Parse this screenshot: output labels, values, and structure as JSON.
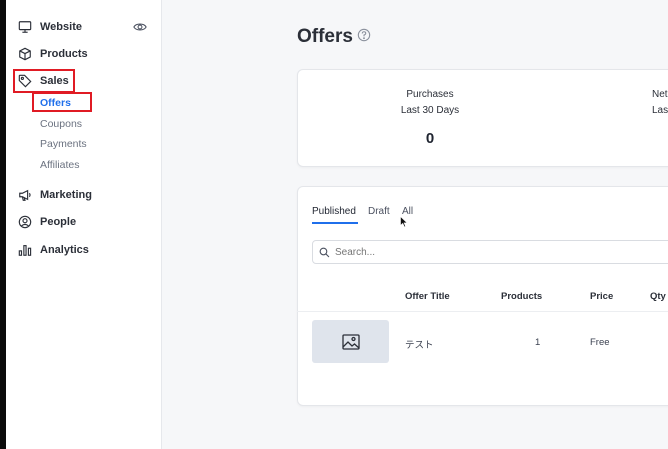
{
  "sidebar": {
    "items": [
      {
        "label": "Website",
        "icon": "monitor-icon"
      },
      {
        "label": "Products",
        "icon": "box-icon"
      },
      {
        "label": "Sales",
        "icon": "tag-icon"
      },
      {
        "label": "Marketing",
        "icon": "megaphone-icon"
      },
      {
        "label": "People",
        "icon": "person-icon"
      },
      {
        "label": "Analytics",
        "icon": "bar-chart-icon"
      }
    ],
    "sales_subitems": [
      "Offers",
      "Coupons",
      "Payments",
      "Affiliates"
    ],
    "eye_icon": "eye-icon"
  },
  "page": {
    "title": "Offers",
    "help_icon": "help-circle-icon"
  },
  "stats": [
    {
      "label_line1": "Purchases",
      "label_line2": "Last 30 Days",
      "value": "0"
    },
    {
      "label_line1": "Net",
      "label_line2": "Last",
      "value": ""
    }
  ],
  "tabs": [
    "Published",
    "Draft",
    "All"
  ],
  "search": {
    "placeholder": "Search..."
  },
  "table": {
    "headers": [
      "Offer Title",
      "Products",
      "Price",
      "Qty"
    ],
    "rows": [
      {
        "title": "テスト",
        "products": "1",
        "price": "Free",
        "thumbnail_icon": "image-icon"
      }
    ]
  },
  "colors": {
    "accent": "#1f6feb",
    "highlight_box": "#e01b24",
    "sidebar_bg": "#ffffff",
    "page_bg": "#f6f7f9"
  }
}
